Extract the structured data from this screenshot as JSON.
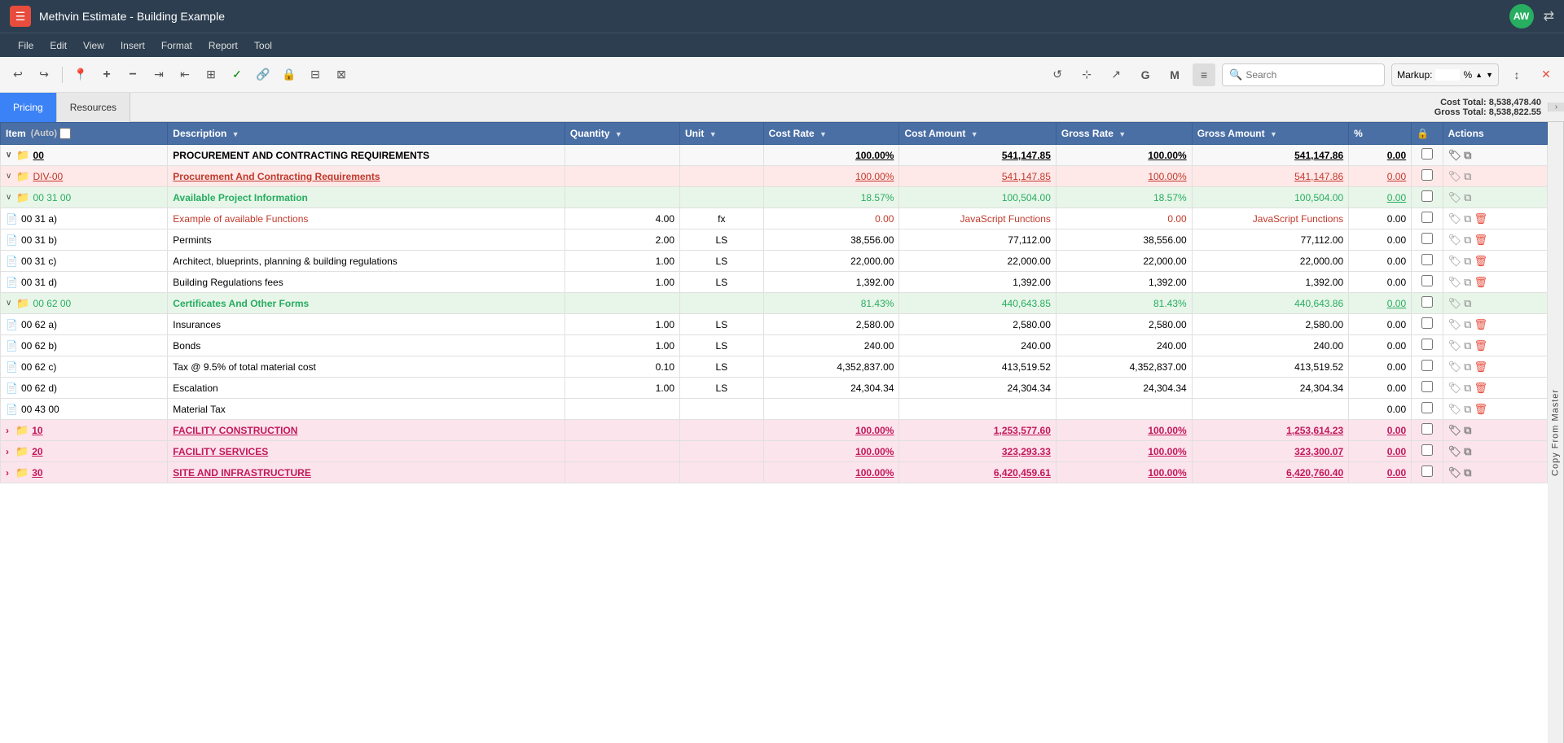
{
  "titleBar": {
    "icon": "☰",
    "title": "Methvin Estimate - Building Example",
    "avatar": "AW"
  },
  "menuBar": {
    "items": [
      "File",
      "Edit",
      "View",
      "Insert",
      "Format",
      "Report",
      "Tool"
    ]
  },
  "toolbar": {
    "searchPlaceholder": "Search",
    "markupLabel": "Markup:",
    "markupValue": "",
    "markupSymbol": "%"
  },
  "tabs": [
    "Pricing",
    "Resources"
  ],
  "activeTab": 0,
  "totals": {
    "costLabel": "Cost Total: 8,538,478.40",
    "grossLabel": "Gross Total: 8,538,822.55"
  },
  "columns": {
    "item": "Item",
    "auto": "(Auto)",
    "description": "Description",
    "quantity": "Quantity",
    "unit": "Unit",
    "costRate": "Cost Rate",
    "costAmount": "Cost Amount",
    "grossRate": "Gross Rate",
    "grossAmount": "Gross Amount",
    "percent": "%",
    "actions": "Actions"
  },
  "rows": [
    {
      "type": "l0",
      "item": "00",
      "description": "PROCUREMENT AND CONTRACTING REQUIREMENTS",
      "quantity": "",
      "unit": "",
      "costRate": "100.00%",
      "costAmount": "541,147.85",
      "grossRate": "100.00%",
      "grossAmount": "541,147.86",
      "percent": "0.00",
      "collapsed": false
    },
    {
      "type": "l1-red",
      "item": "DIV-00",
      "description": "Procurement And Contracting Requirements",
      "quantity": "",
      "unit": "",
      "costRate": "100.00%",
      "costAmount": "541,147.85",
      "grossRate": "100.00%",
      "grossAmount": "541,147.86",
      "percent": "0.00",
      "collapsed": false
    },
    {
      "type": "l2-green",
      "item": "00 31 00",
      "description": "Available Project Information",
      "quantity": "",
      "unit": "",
      "costRate": "18.57%",
      "costAmount": "100,504.00",
      "grossRate": "18.57%",
      "grossAmount": "100,504.00",
      "percent": "0.00",
      "collapsed": false
    },
    {
      "type": "item-red",
      "item": "00 31 a)",
      "description": "Example of available Functions",
      "quantity": "4.00",
      "unit": "fx",
      "costRate": "0.00",
      "costAmount": "JavaScript Functions",
      "grossRate": "0.00",
      "grossAmount": "JavaScript Functions",
      "percent": "0.00"
    },
    {
      "type": "item",
      "item": "00 31 b)",
      "description": "Permints",
      "quantity": "2.00",
      "unit": "LS",
      "costRate": "38,556.00",
      "costAmount": "77,112.00",
      "grossRate": "38,556.00",
      "grossAmount": "77,112.00",
      "percent": "0.00"
    },
    {
      "type": "item",
      "item": "00 31 c)",
      "description": "Architect, blueprints, planning & building regulations",
      "quantity": "1.00",
      "unit": "LS",
      "costRate": "22,000.00",
      "costAmount": "22,000.00",
      "grossRate": "22,000.00",
      "grossAmount": "22,000.00",
      "percent": "0.00"
    },
    {
      "type": "item",
      "item": "00 31 d)",
      "description": "Building Regulations fees",
      "quantity": "1.00",
      "unit": "LS",
      "costRate": "1,392.00",
      "costAmount": "1,392.00",
      "grossRate": "1,392.00",
      "grossAmount": "1,392.00",
      "percent": "0.00"
    },
    {
      "type": "l2-green",
      "item": "00 62 00",
      "description": "Certificates And Other Forms",
      "quantity": "",
      "unit": "",
      "costRate": "81.43%",
      "costAmount": "440,643.85",
      "grossRate": "81.43%",
      "grossAmount": "440,643.86",
      "percent": "0.00",
      "collapsed": false
    },
    {
      "type": "item",
      "item": "00 62 a)",
      "description": "Insurances",
      "quantity": "1.00",
      "unit": "LS",
      "costRate": "2,580.00",
      "costAmount": "2,580.00",
      "grossRate": "2,580.00",
      "grossAmount": "2,580.00",
      "percent": "0.00"
    },
    {
      "type": "item",
      "item": "00 62 b)",
      "description": "Bonds",
      "quantity": "1.00",
      "unit": "LS",
      "costRate": "240.00",
      "costAmount": "240.00",
      "grossRate": "240.00",
      "grossAmount": "240.00",
      "percent": "0.00"
    },
    {
      "type": "item",
      "item": "00 62 c)",
      "description": "Tax @ 9.5% of total material cost",
      "quantity": "0.10",
      "unit": "LS",
      "costRate": "4,352,837.00",
      "costAmount": "413,519.52",
      "grossRate": "4,352,837.00",
      "grossAmount": "413,519.52",
      "percent": "0.00"
    },
    {
      "type": "item",
      "item": "00 62 d)",
      "description": "Escalation",
      "quantity": "1.00",
      "unit": "LS",
      "costRate": "24,304.34",
      "costAmount": "24,304.34",
      "grossRate": "24,304.34",
      "grossAmount": "24,304.34",
      "percent": "0.00"
    },
    {
      "type": "item",
      "item": "00 43 00",
      "description": "Material Tax",
      "quantity": "",
      "unit": "",
      "costRate": "",
      "costAmount": "",
      "grossRate": "",
      "grossAmount": "",
      "percent": "0.00"
    },
    {
      "type": "summary-pink",
      "item": "10",
      "description": "FACILITY CONSTRUCTION",
      "quantity": "",
      "unit": "",
      "costRate": "100.00%",
      "costAmount": "1,253,577.60",
      "grossRate": "100.00%",
      "grossAmount": "1,253,614.23",
      "percent": "0.00"
    },
    {
      "type": "summary-pink",
      "item": "20",
      "description": "FACILITY SERVICES",
      "quantity": "",
      "unit": "",
      "costRate": "100.00%",
      "costAmount": "323,293.33",
      "grossRate": "100.00%",
      "grossAmount": "323,300.07",
      "percent": "0.00"
    },
    {
      "type": "summary-pink",
      "item": "30",
      "description": "SITE AND INFRASTRUCTURE",
      "quantity": "",
      "unit": "",
      "costRate": "100.00%",
      "costAmount": "6,420,459.61",
      "grossRate": "100.00%",
      "grossAmount": "6,420,760.40",
      "percent": "0.00"
    }
  ],
  "copySidebar": "Copy From Master"
}
